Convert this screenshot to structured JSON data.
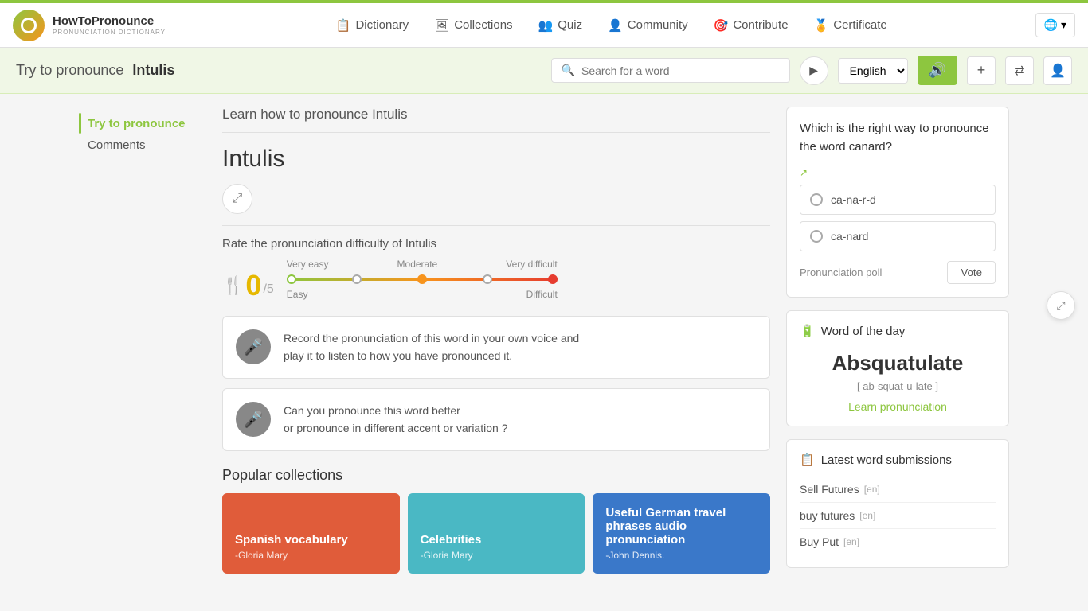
{
  "header": {
    "logo_title": "HowToPronounce",
    "logo_sub": "PRONUNCIATION DICTIONARY",
    "nav": [
      {
        "id": "dictionary",
        "label": "Dictionary",
        "icon": "📋"
      },
      {
        "id": "collections",
        "label": "Collections",
        "icon": "🖼"
      },
      {
        "id": "quiz",
        "label": "Quiz",
        "icon": "👥"
      },
      {
        "id": "community",
        "label": "Community",
        "icon": "👤"
      },
      {
        "id": "contribute",
        "label": "Contribute",
        "icon": "🎯"
      },
      {
        "id": "certificate",
        "label": "Certificate",
        "icon": "🏅"
      }
    ],
    "globe_label": "🌐"
  },
  "search_bar": {
    "title_prefix": "Try to pronounce",
    "title_word": "Intulis",
    "input_placeholder": "Search for a word",
    "language": "English"
  },
  "sidebar": {
    "items": [
      {
        "id": "try-pronounce",
        "label": "Try to pronounce",
        "active": true
      },
      {
        "id": "comments",
        "label": "Comments",
        "active": false
      }
    ]
  },
  "main": {
    "content_header": "Learn how to pronounce Intulis",
    "word": "Intulis",
    "rating_label": "Rate the pronunciation difficulty of Intulis",
    "score": "0",
    "score_denom": "/5",
    "difficulty": {
      "labels_top": [
        "Very easy",
        "Moderate",
        "Very difficult"
      ],
      "labels_bottom_left": "Easy",
      "labels_bottom_right": "Difficult"
    },
    "record_box": {
      "text1": "Record the pronunciation of this word in your own voice and",
      "text2": "play it to listen to how you have pronounced it."
    },
    "pronounce_box": {
      "text1": "Can you pronounce this word better",
      "text2": "or pronounce in different accent or variation ?"
    },
    "collections_title": "Popular collections",
    "collections": [
      {
        "id": "spanish",
        "title": "Spanish vocabulary",
        "author": "-Gloria Mary",
        "color": "red"
      },
      {
        "id": "celebrities",
        "title": "Celebrities",
        "author": "-Gloria Mary",
        "color": "teal"
      },
      {
        "id": "german",
        "title": "Useful German travel phrases audio pronunciation",
        "author": "-John Dennis.",
        "color": "blue"
      }
    ]
  },
  "right_panel": {
    "poll": {
      "question": "Which is the right way to pronounce the word canard?",
      "options": [
        {
          "id": "opt1",
          "label": "ca-na-r-d"
        },
        {
          "id": "opt2",
          "label": "ca-nard"
        }
      ],
      "footer_label": "Pronunciation poll",
      "vote_label": "Vote"
    },
    "word_of_day": {
      "header": "Word of the day",
      "word": "Absquatulate",
      "phonetic": "[ ab-squat-u-late ]",
      "learn_label": "Learn pronunciation"
    },
    "latest": {
      "header": "Latest word submissions",
      "items": [
        {
          "word": "Sell Futures",
          "lang": "[en]"
        },
        {
          "word": "buy futures",
          "lang": "[en]"
        },
        {
          "word": "Buy Put",
          "lang": "[en]"
        }
      ]
    }
  },
  "icons": {
    "mic": "🎤",
    "share": "⤢",
    "search": "🔍",
    "play": "▶",
    "sound": "🔊",
    "add": "+",
    "shuffle": "⇌",
    "user": "👤",
    "fork": "🍴",
    "globe": "🌐",
    "wod": "🔋",
    "latest": "📋",
    "external": "↗"
  }
}
